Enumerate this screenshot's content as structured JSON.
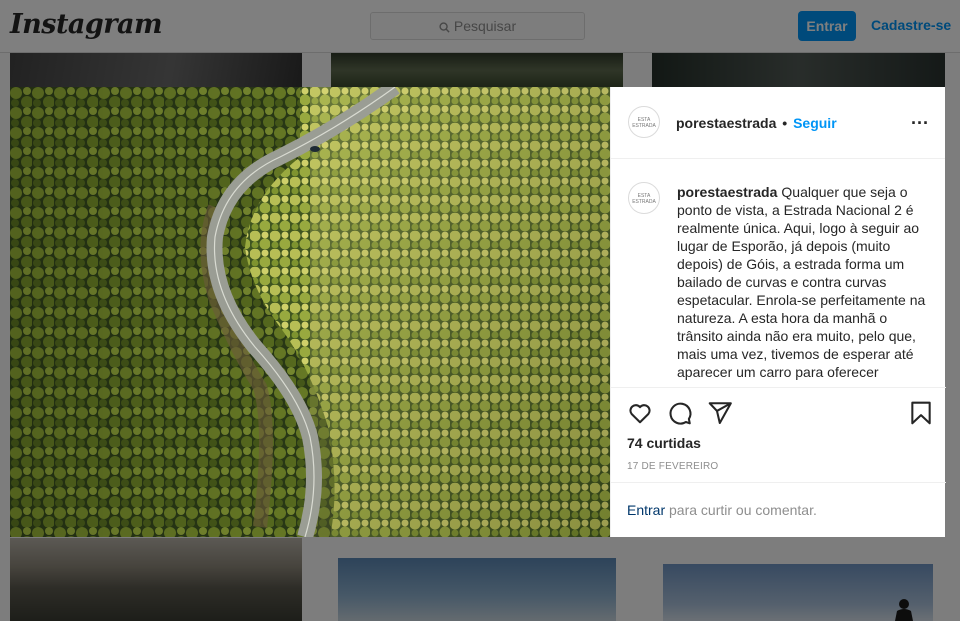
{
  "header": {
    "logo": "Instagram",
    "search_placeholder": "Pesquisar",
    "login_button": "Entrar",
    "signup_link": "Cadastre-se"
  },
  "post": {
    "username": "porestaestrada",
    "separator": "•",
    "follow_label": "Seguir",
    "avatar_text": "ESTA ESTRADA",
    "caption": "Qualquer que seja o ponto de vista, a Estrada Nacional 2 é realmente única. Aqui, logo à seguir ao lugar de Esporão, já depois (muito depois) de Góis, a estrada forma um bailado de curvas e contra curvas espetacular. Enrola-se perfeitamente na natureza. A esta hora da manhã o trânsito ainda não era muito, pelo que, mais uma vez, tivemos de esperar até aparecer um carro para oferecer",
    "likes": "74 curtidas",
    "date": "17 DE FEVEREIRO",
    "login_prompt_link": "Entrar",
    "login_prompt_text": " para curtir ou comentar.",
    "icons": {
      "more": "more-options-icon",
      "like": "heart-icon",
      "comment": "comment-icon",
      "share": "share-icon",
      "save": "bookmark-icon"
    }
  },
  "colors": {
    "accent": "#0095f6",
    "text": "#262626",
    "muted": "#8e8e8e",
    "border": "#dbdbdb"
  }
}
